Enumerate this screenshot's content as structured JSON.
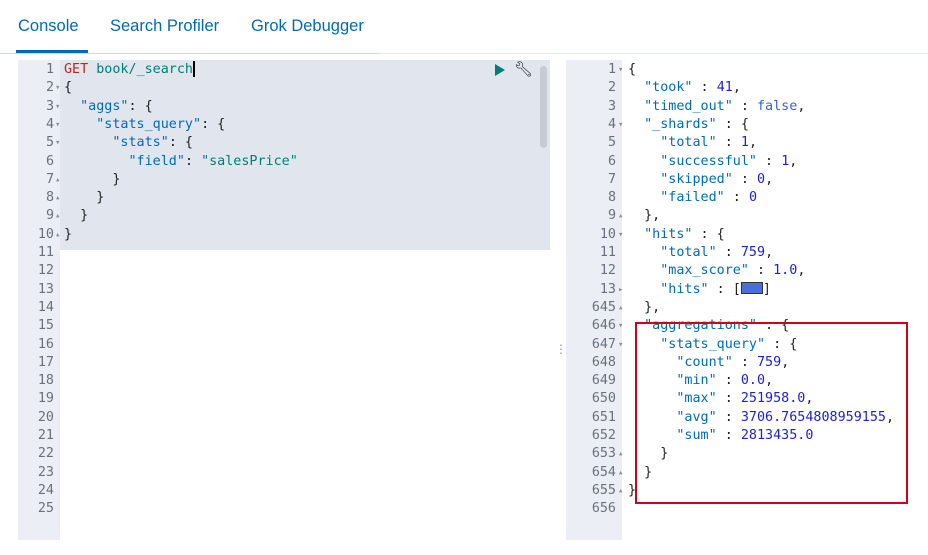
{
  "tabs": [
    {
      "label": "Console"
    },
    {
      "label": "Search Profiler"
    },
    {
      "label": "Grok Debugger"
    }
  ],
  "request": {
    "lines": [
      {
        "num": "1",
        "fold": "",
        "html_parts": [
          {
            "t": "GET ",
            "c": "kw"
          },
          {
            "t": "book/_search",
            "c": "str"
          }
        ],
        "cursor": true
      },
      {
        "num": "2",
        "fold": "▾",
        "html_parts": [
          {
            "t": "{",
            "c": ""
          }
        ]
      },
      {
        "num": "3",
        "fold": "▾",
        "html_parts": [
          {
            "t": "  ",
            "c": ""
          },
          {
            "t": "\"aggs\"",
            "c": "k"
          },
          {
            "t": ": {",
            "c": ""
          }
        ]
      },
      {
        "num": "4",
        "fold": "▾",
        "html_parts": [
          {
            "t": "    ",
            "c": ""
          },
          {
            "t": "\"stats_query\"",
            "c": "k"
          },
          {
            "t": ": {",
            "c": ""
          }
        ]
      },
      {
        "num": "5",
        "fold": "▾",
        "html_parts": [
          {
            "t": "      ",
            "c": ""
          },
          {
            "t": "\"stats\"",
            "c": "k"
          },
          {
            "t": ": {",
            "c": ""
          }
        ]
      },
      {
        "num": "6",
        "fold": "",
        "html_parts": [
          {
            "t": "        ",
            "c": ""
          },
          {
            "t": "\"field\"",
            "c": "k"
          },
          {
            "t": ": ",
            "c": ""
          },
          {
            "t": "\"salesPrice\"",
            "c": "str"
          }
        ]
      },
      {
        "num": "7",
        "fold": "▴",
        "html_parts": [
          {
            "t": "      }",
            "c": ""
          }
        ]
      },
      {
        "num": "8",
        "fold": "▴",
        "html_parts": [
          {
            "t": "    }",
            "c": ""
          }
        ]
      },
      {
        "num": "9",
        "fold": "▴",
        "html_parts": [
          {
            "t": "  }",
            "c": ""
          }
        ]
      },
      {
        "num": "10",
        "fold": "▴",
        "html_parts": [
          {
            "t": "}",
            "c": ""
          }
        ]
      },
      {
        "num": "11",
        "fold": "",
        "html_parts": []
      },
      {
        "num": "12",
        "fold": "",
        "html_parts": []
      },
      {
        "num": "13",
        "fold": "",
        "html_parts": []
      },
      {
        "num": "14",
        "fold": "",
        "html_parts": []
      },
      {
        "num": "15",
        "fold": "",
        "html_parts": []
      },
      {
        "num": "16",
        "fold": "",
        "html_parts": []
      },
      {
        "num": "17",
        "fold": "",
        "html_parts": []
      },
      {
        "num": "18",
        "fold": "",
        "html_parts": []
      },
      {
        "num": "19",
        "fold": "",
        "html_parts": []
      },
      {
        "num": "20",
        "fold": "",
        "html_parts": []
      },
      {
        "num": "21",
        "fold": "",
        "html_parts": []
      },
      {
        "num": "22",
        "fold": "",
        "html_parts": []
      },
      {
        "num": "23",
        "fold": "",
        "html_parts": []
      },
      {
        "num": "24",
        "fold": "",
        "html_parts": []
      },
      {
        "num": "25",
        "fold": "",
        "html_parts": []
      }
    ]
  },
  "response": {
    "lines": [
      {
        "num": "1",
        "fold": "▾",
        "html_parts": [
          {
            "t": "{",
            "c": ""
          }
        ]
      },
      {
        "num": "2",
        "fold": "",
        "html_parts": [
          {
            "t": "  ",
            "c": ""
          },
          {
            "t": "\"took\"",
            "c": "k"
          },
          {
            "t": " : ",
            "c": ""
          },
          {
            "t": "41",
            "c": "num"
          },
          {
            "t": ",",
            "c": ""
          }
        ]
      },
      {
        "num": "3",
        "fold": "",
        "html_parts": [
          {
            "t": "  ",
            "c": ""
          },
          {
            "t": "\"timed_out\"",
            "c": "k"
          },
          {
            "t": " : ",
            "c": ""
          },
          {
            "t": "false",
            "c": "lit"
          },
          {
            "t": ",",
            "c": ""
          }
        ]
      },
      {
        "num": "4",
        "fold": "▾",
        "html_parts": [
          {
            "t": "  ",
            "c": ""
          },
          {
            "t": "\"_shards\"",
            "c": "k"
          },
          {
            "t": " : {",
            "c": ""
          }
        ]
      },
      {
        "num": "5",
        "fold": "",
        "html_parts": [
          {
            "t": "    ",
            "c": ""
          },
          {
            "t": "\"total\"",
            "c": "k"
          },
          {
            "t": " : ",
            "c": ""
          },
          {
            "t": "1",
            "c": "num"
          },
          {
            "t": ",",
            "c": ""
          }
        ]
      },
      {
        "num": "6",
        "fold": "",
        "html_parts": [
          {
            "t": "    ",
            "c": ""
          },
          {
            "t": "\"successful\"",
            "c": "k"
          },
          {
            "t": " : ",
            "c": ""
          },
          {
            "t": "1",
            "c": "num"
          },
          {
            "t": ",",
            "c": ""
          }
        ]
      },
      {
        "num": "7",
        "fold": "",
        "html_parts": [
          {
            "t": "    ",
            "c": ""
          },
          {
            "t": "\"skipped\"",
            "c": "k"
          },
          {
            "t": " : ",
            "c": ""
          },
          {
            "t": "0",
            "c": "num"
          },
          {
            "t": ",",
            "c": ""
          }
        ]
      },
      {
        "num": "8",
        "fold": "",
        "html_parts": [
          {
            "t": "    ",
            "c": ""
          },
          {
            "t": "\"failed\"",
            "c": "k"
          },
          {
            "t": " : ",
            "c": ""
          },
          {
            "t": "0",
            "c": "num"
          }
        ]
      },
      {
        "num": "9",
        "fold": "▴",
        "html_parts": [
          {
            "t": "  },",
            "c": ""
          }
        ]
      },
      {
        "num": "10",
        "fold": "▾",
        "html_parts": [
          {
            "t": "  ",
            "c": ""
          },
          {
            "t": "\"hits\"",
            "c": "k"
          },
          {
            "t": " : {",
            "c": ""
          }
        ]
      },
      {
        "num": "11",
        "fold": "",
        "html_parts": [
          {
            "t": "    ",
            "c": ""
          },
          {
            "t": "\"total\"",
            "c": "k"
          },
          {
            "t": " : ",
            "c": ""
          },
          {
            "t": "759",
            "c": "num"
          },
          {
            "t": ",",
            "c": ""
          }
        ]
      },
      {
        "num": "12",
        "fold": "",
        "html_parts": [
          {
            "t": "    ",
            "c": ""
          },
          {
            "t": "\"max_score\"",
            "c": "k"
          },
          {
            "t": " : ",
            "c": ""
          },
          {
            "t": "1.0",
            "c": "num"
          },
          {
            "t": ",",
            "c": ""
          }
        ]
      },
      {
        "num": "13",
        "fold": "▸",
        "html_parts": [
          {
            "t": "    ",
            "c": ""
          },
          {
            "t": "\"hits\"",
            "c": "k"
          },
          {
            "t": " : [",
            "c": ""
          },
          {
            "t": "",
            "c": "badge"
          },
          {
            "t": "]",
            "c": ""
          }
        ]
      },
      {
        "num": "645",
        "fold": "▴",
        "html_parts": [
          {
            "t": "  },",
            "c": ""
          }
        ]
      },
      {
        "num": "646",
        "fold": "▾",
        "html_parts": [
          {
            "t": "  ",
            "c": ""
          },
          {
            "t": "\"aggregations\"",
            "c": "k"
          },
          {
            "t": " : {",
            "c": ""
          }
        ]
      },
      {
        "num": "647",
        "fold": "▾",
        "html_parts": [
          {
            "t": "    ",
            "c": ""
          },
          {
            "t": "\"stats_query\"",
            "c": "k"
          },
          {
            "t": " : {",
            "c": ""
          }
        ]
      },
      {
        "num": "648",
        "fold": "",
        "html_parts": [
          {
            "t": "      ",
            "c": ""
          },
          {
            "t": "\"count\"",
            "c": "k"
          },
          {
            "t": " : ",
            "c": ""
          },
          {
            "t": "759",
            "c": "num"
          },
          {
            "t": ",",
            "c": ""
          }
        ]
      },
      {
        "num": "649",
        "fold": "",
        "html_parts": [
          {
            "t": "      ",
            "c": ""
          },
          {
            "t": "\"min\"",
            "c": "k"
          },
          {
            "t": " : ",
            "c": ""
          },
          {
            "t": "0.0",
            "c": "num"
          },
          {
            "t": ",",
            "c": ""
          }
        ]
      },
      {
        "num": "650",
        "fold": "",
        "html_parts": [
          {
            "t": "      ",
            "c": ""
          },
          {
            "t": "\"max\"",
            "c": "k"
          },
          {
            "t": " : ",
            "c": ""
          },
          {
            "t": "251958.0",
            "c": "num"
          },
          {
            "t": ",",
            "c": ""
          }
        ]
      },
      {
        "num": "651",
        "fold": "",
        "html_parts": [
          {
            "t": "      ",
            "c": ""
          },
          {
            "t": "\"avg\"",
            "c": "k"
          },
          {
            "t": " : ",
            "c": ""
          },
          {
            "t": "3706.7654808959155",
            "c": "num"
          },
          {
            "t": ",",
            "c": ""
          }
        ]
      },
      {
        "num": "652",
        "fold": "",
        "html_parts": [
          {
            "t": "      ",
            "c": ""
          },
          {
            "t": "\"sum\"",
            "c": "k"
          },
          {
            "t": " : ",
            "c": ""
          },
          {
            "t": "2813435.0",
            "c": "num"
          }
        ]
      },
      {
        "num": "653",
        "fold": "▴",
        "html_parts": [
          {
            "t": "    }",
            "c": ""
          }
        ]
      },
      {
        "num": "654",
        "fold": "▴",
        "html_parts": [
          {
            "t": "  }",
            "c": ""
          }
        ]
      },
      {
        "num": "655",
        "fold": "▴",
        "html_parts": [
          {
            "t": "}",
            "c": ""
          }
        ]
      },
      {
        "num": "656",
        "fold": "",
        "html_parts": []
      }
    ]
  },
  "icons": {
    "run": "play-icon",
    "settings": "wrench-icon",
    "divider": "drag-handle-icon"
  },
  "colors": {
    "accent": "#006bb4",
    "highlight_box": "#d0021b"
  }
}
